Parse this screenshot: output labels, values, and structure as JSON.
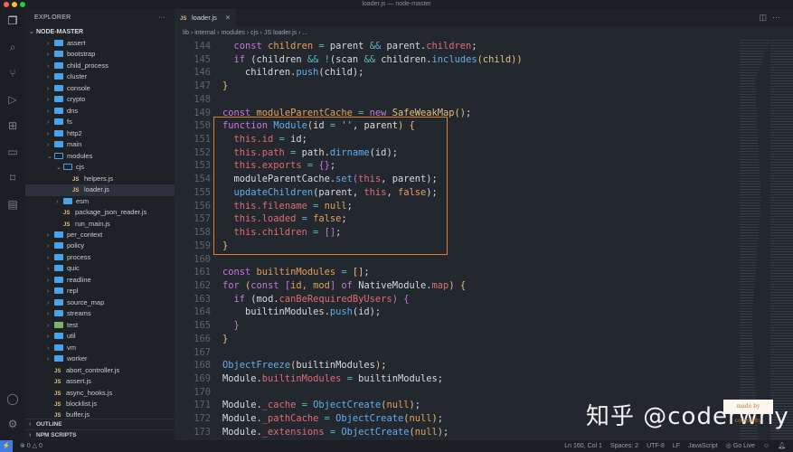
{
  "window_title": "loader.js — node-master",
  "sidebar": {
    "title": "EXPLORER",
    "more": "···",
    "root": "NODE-MASTER",
    "items": [
      {
        "label": "assert",
        "type": "folder",
        "depth": 1
      },
      {
        "label": "bootstrap",
        "type": "folder",
        "depth": 1
      },
      {
        "label": "child_process",
        "type": "folder",
        "depth": 1
      },
      {
        "label": "cluster",
        "type": "folder",
        "depth": 1
      },
      {
        "label": "console",
        "type": "folder",
        "depth": 1
      },
      {
        "label": "crypto",
        "type": "folder",
        "depth": 1
      },
      {
        "label": "dns",
        "type": "folder",
        "depth": 1
      },
      {
        "label": "fs",
        "type": "folder",
        "depth": 1
      },
      {
        "label": "http2",
        "type": "folder",
        "depth": 1
      },
      {
        "label": "main",
        "type": "folder",
        "depth": 1
      },
      {
        "label": "modules",
        "type": "folder-open",
        "depth": 1
      },
      {
        "label": "cjs",
        "type": "folder-open",
        "depth": 2
      },
      {
        "label": "helpers.js",
        "type": "js",
        "depth": 3
      },
      {
        "label": "loader.js",
        "type": "js",
        "depth": 3,
        "selected": true
      },
      {
        "label": "esm",
        "type": "folder",
        "depth": 2
      },
      {
        "label": "package_json_reader.js",
        "type": "js",
        "depth": 2
      },
      {
        "label": "run_main.js",
        "type": "js",
        "depth": 2
      },
      {
        "label": "per_context",
        "type": "folder",
        "depth": 1
      },
      {
        "label": "policy",
        "type": "folder",
        "depth": 1
      },
      {
        "label": "process",
        "type": "folder",
        "depth": 1
      },
      {
        "label": "quic",
        "type": "folder",
        "depth": 1
      },
      {
        "label": "readline",
        "type": "folder",
        "depth": 1
      },
      {
        "label": "repl",
        "type": "folder",
        "depth": 1
      },
      {
        "label": "source_map",
        "type": "folder",
        "depth": 1
      },
      {
        "label": "streams",
        "type": "folder",
        "depth": 1
      },
      {
        "label": "test",
        "type": "folder-green",
        "depth": 1
      },
      {
        "label": "util",
        "type": "folder",
        "depth": 1
      },
      {
        "label": "vm",
        "type": "folder",
        "depth": 1
      },
      {
        "label": "worker",
        "type": "folder",
        "depth": 1
      },
      {
        "label": "abort_controller.js",
        "type": "js",
        "depth": 1
      },
      {
        "label": "assert.js",
        "type": "js",
        "depth": 1
      },
      {
        "label": "async_hooks.js",
        "type": "js",
        "depth": 1
      },
      {
        "label": "blocklist.js",
        "type": "js",
        "depth": 1
      },
      {
        "label": "buffer.js",
        "type": "js",
        "depth": 1
      }
    ],
    "outline": "OUTLINE",
    "npm_scripts": "NPM SCRIPTS"
  },
  "tab": {
    "icon": "JS",
    "label": "loader.js",
    "close": "✕"
  },
  "breadcrumb": [
    "lib",
    "internal",
    "modules",
    "cjs",
    "JS loader.js",
    "..."
  ],
  "editor": {
    "lines": [
      {
        "n": "144",
        "t": [
          [
            "  ",
            "t"
          ],
          [
            "const ",
            "k"
          ],
          [
            "children ",
            "v"
          ],
          [
            "= ",
            "o"
          ],
          [
            "parent ",
            "t"
          ],
          [
            "&& ",
            "o"
          ],
          [
            "parent.",
            "t"
          ],
          [
            "children",
            "p"
          ],
          [
            ";",
            "t"
          ]
        ]
      },
      {
        "n": "145",
        "t": [
          [
            "  ",
            "t"
          ],
          [
            "if ",
            "k"
          ],
          [
            "(children ",
            "t"
          ],
          [
            "&& ",
            "o"
          ],
          [
            "!",
            "o"
          ],
          [
            "(scan ",
            "t"
          ],
          [
            "&& ",
            "o"
          ],
          [
            "children.",
            "t"
          ],
          [
            "includes",
            "f"
          ],
          [
            "(child))",
            "y"
          ]
        ]
      },
      {
        "n": "146",
        "t": [
          [
            "    children.",
            "t"
          ],
          [
            "push",
            "f"
          ],
          [
            "(child)",
            "t"
          ],
          [
            ";",
            "t"
          ]
        ]
      },
      {
        "n": "147",
        "t": [
          [
            "}",
            "y"
          ]
        ]
      },
      {
        "n": "148",
        "t": []
      },
      {
        "n": "149",
        "t": [
          [
            "const ",
            "k"
          ],
          [
            "moduleParentCache ",
            "v"
          ],
          [
            "= ",
            "o"
          ],
          [
            "new ",
            "k"
          ],
          [
            "SafeWeakMap",
            "c"
          ],
          [
            "()",
            "y"
          ],
          [
            ";",
            "t"
          ]
        ]
      },
      {
        "n": "150",
        "t": [
          [
            "function ",
            "k"
          ],
          [
            "Module",
            "f"
          ],
          [
            "(",
            "y"
          ],
          [
            "id ",
            "t"
          ],
          [
            "= ",
            "o"
          ],
          [
            "''",
            "s"
          ],
          [
            ", parent",
            "t"
          ],
          [
            ") {",
            "y"
          ]
        ]
      },
      {
        "n": "151",
        "t": [
          [
            "  ",
            "t"
          ],
          [
            "this.id ",
            "p"
          ],
          [
            "= ",
            "o"
          ],
          [
            "id;",
            "t"
          ]
        ]
      },
      {
        "n": "152",
        "t": [
          [
            "  ",
            "t"
          ],
          [
            "this.path ",
            "p"
          ],
          [
            "= ",
            "o"
          ],
          [
            "path.",
            "t"
          ],
          [
            "dirname",
            "f"
          ],
          [
            "(id);",
            "t"
          ]
        ]
      },
      {
        "n": "153",
        "t": [
          [
            "  ",
            "t"
          ],
          [
            "this.exports ",
            "p"
          ],
          [
            "= ",
            "o"
          ],
          [
            "{}",
            "k"
          ],
          [
            ";",
            "t"
          ]
        ]
      },
      {
        "n": "154",
        "t": [
          [
            "  moduleParentCache.",
            "t"
          ],
          [
            "set",
            "f"
          ],
          [
            "(",
            "k"
          ],
          [
            "this",
            "p"
          ],
          [
            ", parent)",
            "t"
          ],
          [
            ";",
            "t"
          ]
        ]
      },
      {
        "n": "155",
        "t": [
          [
            "  ",
            "t"
          ],
          [
            "updateChildren",
            "f"
          ],
          [
            "(parent, ",
            "t"
          ],
          [
            "this",
            "p"
          ],
          [
            ", ",
            "t"
          ],
          [
            "false",
            "v"
          ],
          [
            ");",
            "t"
          ]
        ]
      },
      {
        "n": "156",
        "t": [
          [
            "  ",
            "t"
          ],
          [
            "this.filename ",
            "p"
          ],
          [
            "= ",
            "o"
          ],
          [
            "null",
            "v"
          ],
          [
            ";",
            "t"
          ]
        ]
      },
      {
        "n": "157",
        "t": [
          [
            "  ",
            "t"
          ],
          [
            "this.loaded ",
            "p"
          ],
          [
            "= ",
            "o"
          ],
          [
            "false",
            "v"
          ],
          [
            ";",
            "t"
          ]
        ]
      },
      {
        "n": "158",
        "t": [
          [
            "  ",
            "t"
          ],
          [
            "this.children ",
            "p"
          ],
          [
            "= ",
            "o"
          ],
          [
            "[]",
            "k"
          ],
          [
            ";",
            "t"
          ]
        ]
      },
      {
        "n": "159",
        "t": [
          [
            "}",
            "y"
          ]
        ]
      },
      {
        "n": "160",
        "t": []
      },
      {
        "n": "161",
        "t": [
          [
            "const ",
            "k"
          ],
          [
            "builtinModules ",
            "v"
          ],
          [
            "= ",
            "o"
          ],
          [
            "[]",
            "y"
          ],
          [
            ";",
            "t"
          ]
        ]
      },
      {
        "n": "162",
        "t": [
          [
            "for ",
            "k"
          ],
          [
            "(",
            "y"
          ],
          [
            "const ",
            "k"
          ],
          [
            "[",
            "k"
          ],
          [
            "id, mod",
            "v"
          ],
          [
            "] ",
            "k"
          ],
          [
            "of ",
            "k"
          ],
          [
            "NativeModule.",
            "t"
          ],
          [
            "map",
            "p"
          ],
          [
            ") {",
            "y"
          ]
        ]
      },
      {
        "n": "163",
        "t": [
          [
            "  ",
            "t"
          ],
          [
            "if ",
            "k"
          ],
          [
            "(mod.",
            "t"
          ],
          [
            "canBeRequiredByUsers",
            "p"
          ],
          [
            ") {",
            "k"
          ]
        ]
      },
      {
        "n": "164",
        "t": [
          [
            "    builtinModules.",
            "t"
          ],
          [
            "push",
            "f"
          ],
          [
            "(id);",
            "t"
          ]
        ]
      },
      {
        "n": "165",
        "t": [
          [
            "  ",
            "t"
          ],
          [
            "}",
            "k"
          ]
        ]
      },
      {
        "n": "166",
        "t": [
          [
            "}",
            "y"
          ]
        ]
      },
      {
        "n": "167",
        "t": []
      },
      {
        "n": "168",
        "t": [
          [
            "ObjectFreeze",
            "f"
          ],
          [
            "(",
            "y"
          ],
          [
            "builtinModules",
            "t"
          ],
          [
            ")",
            "y"
          ],
          [
            ";",
            "t"
          ]
        ]
      },
      {
        "n": "169",
        "t": [
          [
            "Module.",
            "t"
          ],
          [
            "builtinModules ",
            "p"
          ],
          [
            "= ",
            "o"
          ],
          [
            "builtinModules;",
            "t"
          ]
        ]
      },
      {
        "n": "170",
        "t": []
      },
      {
        "n": "171",
        "t": [
          [
            "Module.",
            "t"
          ],
          [
            "_cache ",
            "p"
          ],
          [
            "= ",
            "o"
          ],
          [
            "ObjectCreate",
            "f"
          ],
          [
            "(",
            "y"
          ],
          [
            "null",
            "v"
          ],
          [
            ")",
            "y"
          ],
          [
            ";",
            "t"
          ]
        ]
      },
      {
        "n": "172",
        "t": [
          [
            "Module.",
            "t"
          ],
          [
            "_pathCache ",
            "p"
          ],
          [
            "= ",
            "o"
          ],
          [
            "ObjectCreate",
            "f"
          ],
          [
            "(",
            "y"
          ],
          [
            "null",
            "v"
          ],
          [
            ")",
            "y"
          ],
          [
            ";",
            "t"
          ]
        ]
      },
      {
        "n": "173",
        "t": [
          [
            "Module.",
            "t"
          ],
          [
            "_extensions ",
            "p"
          ],
          [
            "= ",
            "o"
          ],
          [
            "ObjectCreate",
            "f"
          ],
          [
            "(",
            "y"
          ],
          [
            "null",
            "v"
          ],
          [
            ")",
            "y"
          ],
          [
            ";",
            "t"
          ]
        ]
      }
    ]
  },
  "status": {
    "errors": "⊗ 0",
    "warnings": "△ 0",
    "position": "Ln 160, Col 1",
    "spaces": "Spaces: 2",
    "encoding": "UTF-8",
    "eol": "LF",
    "language": "JavaScript",
    "golive": "◎ Go Live"
  },
  "watermark": {
    "text": "知乎 @coderwhy",
    "badge": "made by coderwhy"
  },
  "colors": {
    "accent": "#3d7de0",
    "highlight_box": "#e07a2f",
    "editor_bg": "#23272e"
  }
}
